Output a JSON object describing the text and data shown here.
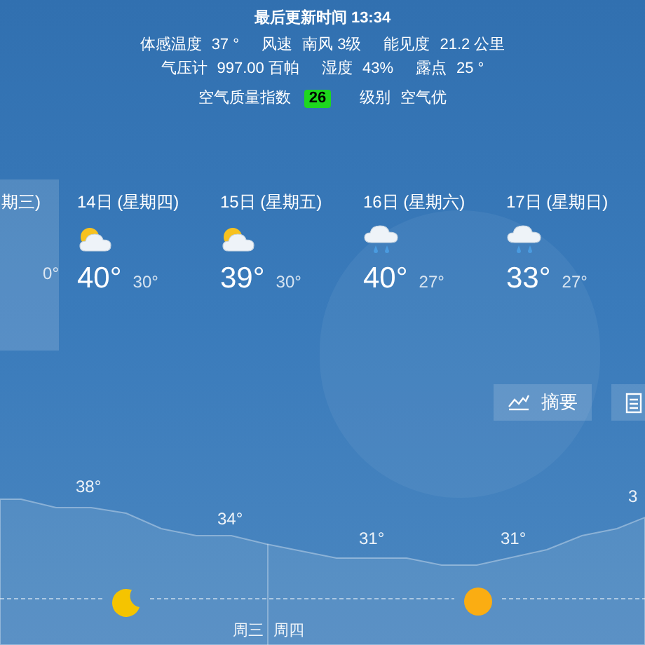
{
  "header": {
    "title": "最后更新时间 13:34"
  },
  "details": [
    [
      {
        "label": "体感温度",
        "value": "37 °"
      },
      {
        "label": "风速",
        "value": "南风 3级"
      },
      {
        "label": "能见度",
        "value": "21.2 公里"
      }
    ],
    [
      {
        "label": "气压计",
        "value": "997.00 百帕"
      },
      {
        "label": "湿度",
        "value": "43%"
      },
      {
        "label": "露点",
        "value": "25 °"
      }
    ]
  ],
  "air_quality": {
    "label": "空气质量指数",
    "value": "26",
    "color": "#1ed71e",
    "level_label": "级别",
    "level_value": "空气优"
  },
  "forecast": [
    {
      "date": "期三)",
      "kind": "none",
      "low": "0°",
      "selected": true
    },
    {
      "date": "14日 (星期四)",
      "kind": "partly-cloudy",
      "high": "40°",
      "low": "30°",
      "selected": false
    },
    {
      "date": "15日 (星期五)",
      "kind": "partly-cloudy",
      "high": "39°",
      "low": "30°",
      "selected": false
    },
    {
      "date": "16日 (星期六)",
      "kind": "rain",
      "high": "40°",
      "low": "27°",
      "selected": false
    },
    {
      "date": "17日 (星期日)",
      "kind": "rain",
      "high": "33°",
      "low": "27°",
      "selected": false
    }
  ],
  "view_buttons": [
    {
      "kind": "summary",
      "label": "摘要"
    },
    {
      "kind": "list"
    }
  ],
  "hourly_labels": [
    "38°",
    "34°",
    "31°",
    "31°",
    "3"
  ],
  "day_labels": [
    "周三",
    "周四"
  ]
}
